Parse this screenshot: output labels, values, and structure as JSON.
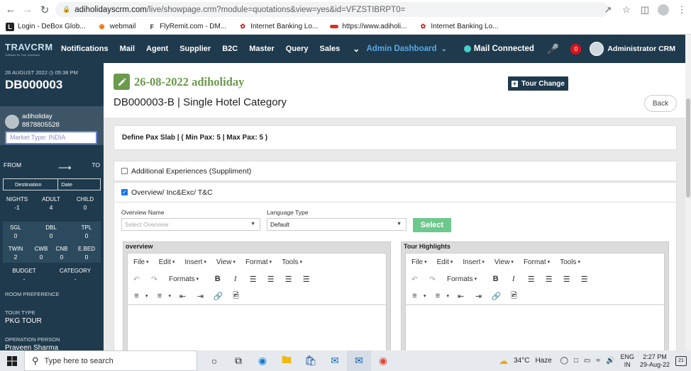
{
  "browser": {
    "url_host": "adiholidayscrm.com",
    "url_path": "/live/showpage.crm?module=quotations&view=yes&id=VFZSTIBRPT0=",
    "bookmarks": [
      {
        "label": "Login - DeBox Glob..."
      },
      {
        "label": "webmail"
      },
      {
        "label": "FlyRemit.com - DM..."
      },
      {
        "label": "Internet Banking Lo..."
      },
      {
        "label": "https://www.adiholi..."
      },
      {
        "label": "Internet Banking Lo..."
      }
    ]
  },
  "topnav": {
    "logo_main": "TRAVCRM",
    "logo_tag": "Software for Tour Operators",
    "menu": [
      "Notifications",
      "Mail",
      "Agent",
      "Supplier",
      "B2C",
      "Master",
      "Query",
      "Sales"
    ],
    "admin_dashboard": "Admin Dashboard",
    "mail_connected": "Mail Connected",
    "notif_count": "0",
    "user_name": "Administrator CRM",
    "colors": {
      "nav_bg": "#1f3a4d",
      "accent_blue": "#5aa9e6",
      "mail_dot": "#45d1c4"
    }
  },
  "sidebar": {
    "date": "26 AUGUST 2022 ◷ 05:38 PM",
    "code": "DB000003",
    "agent_name": "adiholiday",
    "agent_phone": "8878805528",
    "market_type": "Market Type: INDIA",
    "from_label": "FROM",
    "to_label": "TO",
    "destination_label": "Destination",
    "date_label": "Date",
    "nights_label": "NIGHTS",
    "nights": "-1",
    "adult_label": "ADULT",
    "adult": "4",
    "child_label": "CHILD",
    "child": "0",
    "sgl_label": "SGL",
    "sgl": "0",
    "dbl_label": "DBL",
    "dbl": "0",
    "tpl_label": "TPL",
    "tpl": "0",
    "twin_label": "TWIN",
    "twin": "2",
    "cwb_label": "CWB",
    "cwb": "0",
    "cnb_label": "CNB",
    "cnb": "0",
    "ebed_label": "E.BED",
    "ebed": "0",
    "budget_label": "BUDGET",
    "budget": "-",
    "category_label": "CATEGORY",
    "category": "-",
    "room_pref_label": "ROOM PREFERENCE",
    "tour_type_label": "TOUR TYPE",
    "tour_type": "PKG TOUR",
    "operation_person_label": "OPERATION PERSON",
    "operation_person": "Praveen Sharma"
  },
  "header": {
    "title": "26-08-2022 adiholiday",
    "subtitle": "DB000003-B | Single Hotel Category",
    "tour_change": "Tour Change",
    "back": "Back",
    "title_color": "#6a9a4c"
  },
  "pax": {
    "text": "Define Pax Slab  | ( Min Pax: 5 | Max Pax: 5 )"
  },
  "sections": {
    "additional_experiences": "Additional Experiences (Suppliment)",
    "overview_inc_exc": "Overview/ Inc&Exc/ T&C"
  },
  "overview_form": {
    "overview_name_label": "Overview Name",
    "overview_name_placeholder": "Select Overview",
    "language_type_label": "Language Type",
    "language_type_value": "Default",
    "select_button": "Select"
  },
  "editors": {
    "left_title": "overview",
    "right_title": "Tour Highlights",
    "menu": [
      "File",
      "Edit",
      "Insert",
      "View",
      "Format",
      "Tools"
    ],
    "formats_label": "Formats"
  },
  "taskbar": {
    "search_placeholder": "Type here to search",
    "weather_temp": "34°C",
    "weather_desc": "Haze",
    "lang_line1": "ENG",
    "lang_line2": "IN",
    "time": "2:27 PM",
    "date": "29-Aug-22",
    "notif_count": "21"
  }
}
